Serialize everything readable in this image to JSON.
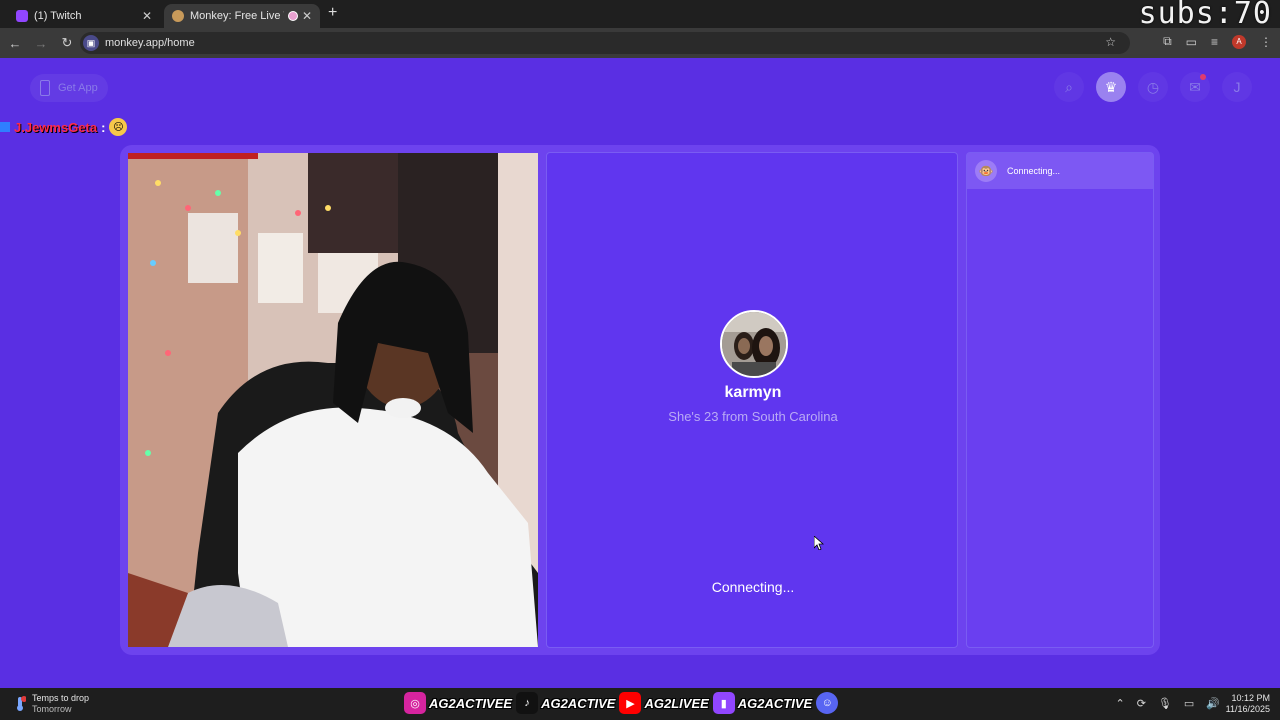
{
  "browser": {
    "tabs": [
      {
        "title": "(1) Twitch",
        "active": false
      },
      {
        "title": "Monkey: Free Live Video Ch",
        "active": true
      }
    ],
    "url": "monkey.app/home"
  },
  "overlay": {
    "subs": "subs:70"
  },
  "header": {
    "get_app_label": "Get App",
    "profile_initial": "J"
  },
  "chat": {
    "username": "J.JewmsGeta",
    "colon": ":"
  },
  "match": {
    "name": "karmyn",
    "info": "She's 23 from South Carolina",
    "status": "Connecting..."
  },
  "side": {
    "status": "Connecting..."
  },
  "taskbar": {
    "weather_line1": "Temps to drop",
    "weather_line2": "Tomorrow",
    "weather_badge": "1",
    "socials": [
      {
        "icon": "instagram-icon",
        "label": "AG2ACTIVEE",
        "color": "#d6249f"
      },
      {
        "icon": "tiktok-icon",
        "label": "AG2ACTIVE",
        "color": "#111111"
      },
      {
        "icon": "youtube-icon",
        "label": "AG2LIVEE",
        "color": "#ff0000"
      },
      {
        "icon": "twitch-icon",
        "label": "AG2ACTIVE",
        "color": "#9146ff"
      }
    ],
    "time": "10:12 PM",
    "date": "11/16/2025"
  },
  "colors": {
    "page_bg": "#5a2fe3",
    "panel": "#6036ef",
    "accent": "#7d58f3"
  }
}
